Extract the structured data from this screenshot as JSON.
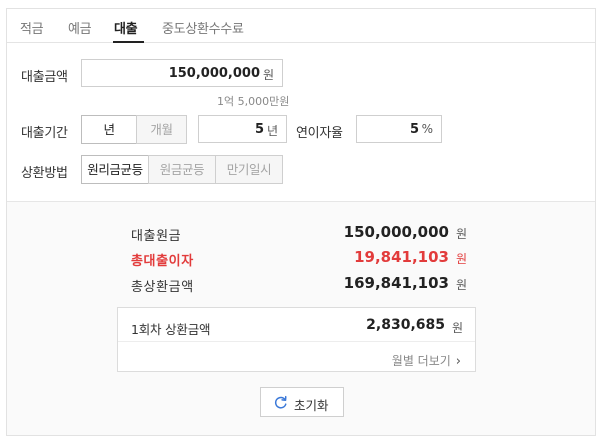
{
  "tabs": [
    "적금",
    "예금",
    "대출",
    "중도상환수수료"
  ],
  "active_tab": "대출",
  "form": {
    "loan_amount_label": "대출금액",
    "loan_amount_value": "150,000,000",
    "loan_amount_unit": "원",
    "loan_amount_hint": "1억 5,000만원",
    "loan_period_label": "대출기간",
    "period_year_option": "년",
    "period_month_option": "개월",
    "period_value": "5",
    "period_unit": "년",
    "interest_label": "연이자율",
    "interest_value": "5",
    "interest_unit": "%",
    "repayment_label": "상환방법",
    "repayment_options": [
      "원리금균등",
      "원금균등",
      "만기일시"
    ],
    "repayment_selected": "원리금균등"
  },
  "result": {
    "principal_label": "대출원금",
    "principal_value": "150,000,000",
    "total_interest_label": "총대출이자",
    "total_interest_value": "19,841,103",
    "total_repay_label": "총상환금액",
    "total_repay_value": "169,841,103",
    "unit": "원",
    "first_payment_label": "1회차 상환금액",
    "first_payment_value": "2,830,685",
    "first_payment_unit": "원",
    "monthly_more_label": "월별 더보기"
  },
  "reset_label": "초기화",
  "colors": {
    "accent_red": "#e23b3b",
    "accent_blue": "#3a78d8"
  },
  "icons": {
    "more": "chevron-right-icon",
    "reset": "refresh-icon"
  }
}
